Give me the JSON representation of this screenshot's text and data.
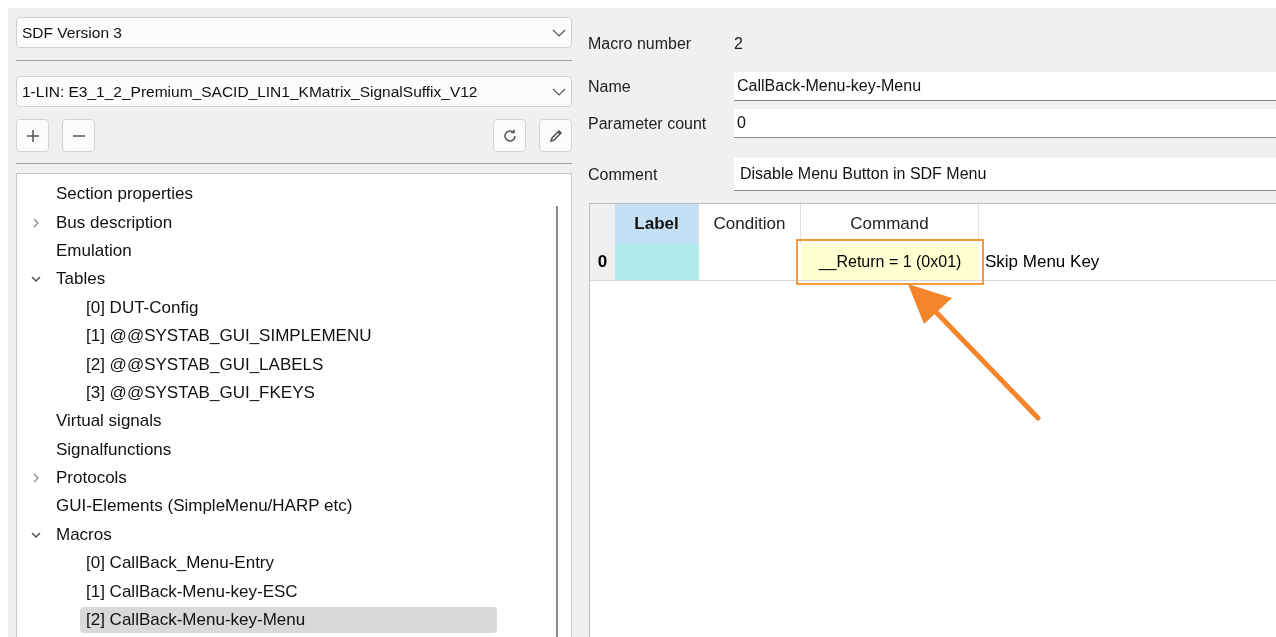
{
  "selectors": [
    {
      "value": "SDF Version 3"
    },
    {
      "value": "1-LIN: E3_1_2_Premium_SACID_LIN1_KMatrix_SignalSuffix_V12"
    }
  ],
  "toolbar": [
    {
      "kind": "add"
    },
    {
      "kind": "remove"
    },
    {
      "kind": "spacer"
    },
    {
      "kind": "refresh"
    },
    {
      "kind": "edit"
    }
  ],
  "tree": [
    {
      "label": "Section properties",
      "selected": false
    },
    {
      "label": "Bus description",
      "expanded": false,
      "selected": false
    },
    {
      "label": "Emulation",
      "selected": false
    },
    {
      "label": "Tables",
      "expanded": true,
      "selected": false,
      "children": [
        {
          "label": "[0] DUT-Config",
          "selected": false
        },
        {
          "label": "[1] @@SYSTAB_GUI_SIMPLEMENU",
          "selected": false
        },
        {
          "label": "[2] @@SYSTAB_GUI_LABELS",
          "selected": false
        },
        {
          "label": "[3] @@SYSTAB_GUI_FKEYS",
          "selected": false
        }
      ]
    },
    {
      "label": "Virtual signals",
      "selected": false
    },
    {
      "label": "Signalfunctions",
      "selected": false
    },
    {
      "label": "Protocols",
      "expanded": false,
      "selected": false
    },
    {
      "label": "GUI-Elements (SimpleMenu/HARP etc)",
      "selected": false
    },
    {
      "label": "Macros",
      "expanded": true,
      "selected": false,
      "children": [
        {
          "label": "[0] CallBack_Menu-Entry",
          "selected": false
        },
        {
          "label": "[1] CallBack-Menu-key-ESC",
          "selected": false
        },
        {
          "label": "[2] CallBack-Menu-key-Menu",
          "selected": true
        }
      ]
    }
  ],
  "macro": {
    "number_label": "Macro number",
    "number": "2",
    "fields": [
      {
        "label": "Name",
        "value": "CallBack-Menu-key-Menu"
      },
      {
        "label": "Parameter count",
        "value": "0"
      },
      {
        "label": "Comment",
        "value": "Disable Menu Button in SDF Menu"
      }
    ]
  },
  "table": {
    "columns": [
      {
        "label": "Label",
        "selected": true
      },
      {
        "label": "Condition",
        "selected": false
      },
      {
        "label": "Command",
        "selected": false
      }
    ],
    "rows": [
      {
        "index": "0",
        "label": "",
        "condition": "",
        "command": "__Return = 1 (0x01)",
        "column_4": "Skip Menu Key",
        "highlighted": true
      }
    ]
  }
}
